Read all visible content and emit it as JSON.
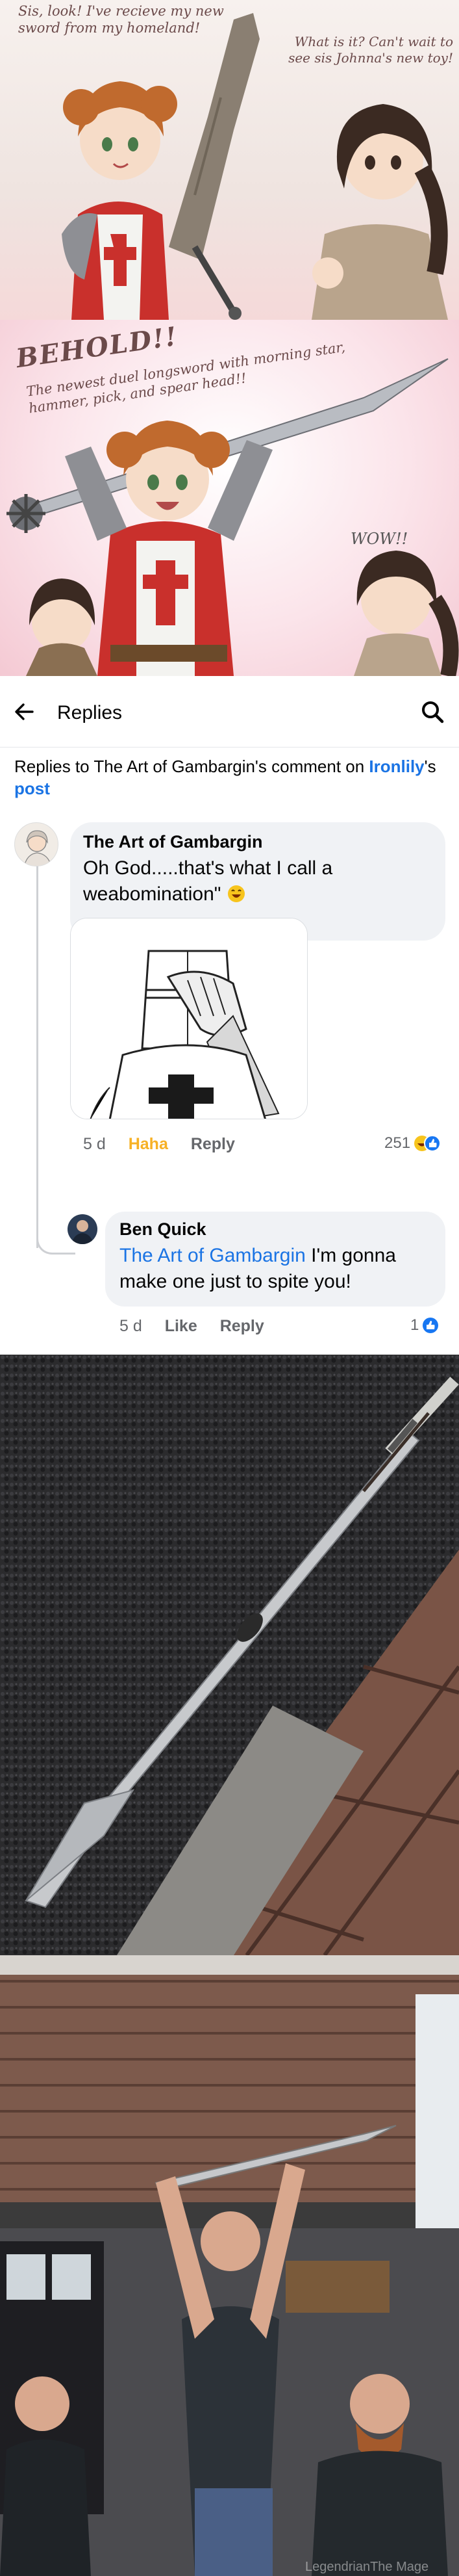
{
  "comic_top": {
    "caption_left": "Sis, look! I've recieve my new sword from my homeland!",
    "caption_right": "What is it? Can't wait to see sis Johnna's new toy!"
  },
  "comic_bottom": {
    "behold": "BEHOLD!!",
    "subcaption": "The newest duel longsword with morning star, hammer, pick, and spear head!!",
    "wow": "WOW!!"
  },
  "fb": {
    "header_title": "Replies",
    "context_prefix": "Replies to The Art of Gambargin's comment on ",
    "context_page": "Ironlily",
    "context_possessive": "'s ",
    "context_post": "post",
    "comment": {
      "author": "The Art of Gambargin",
      "text": "Oh God.....that's what I call a weabomination\" ",
      "time": "5 d",
      "reaction_label": "Haha",
      "reply_label": "Reply",
      "reaction_count": "251"
    },
    "reply": {
      "author": "Ben Quick",
      "mention": "The Art of Gambargin",
      "text": " I'm gonna make one just to spite you!",
      "time": "5 d",
      "like_label": "Like",
      "reply_label": "Reply",
      "reaction_count": "1"
    }
  },
  "watermark": "LegendrianThe Mage",
  "icons": [
    "back-arrow-icon",
    "search-icon",
    "haha-emoji-icon",
    "like-icon",
    "laughing-emoji-icon"
  ],
  "colors": {
    "link": "#1b74e4",
    "haha": "#f7b125",
    "like": "#1877f2",
    "bubble": "#f0f2f5",
    "meta": "#65676b"
  }
}
